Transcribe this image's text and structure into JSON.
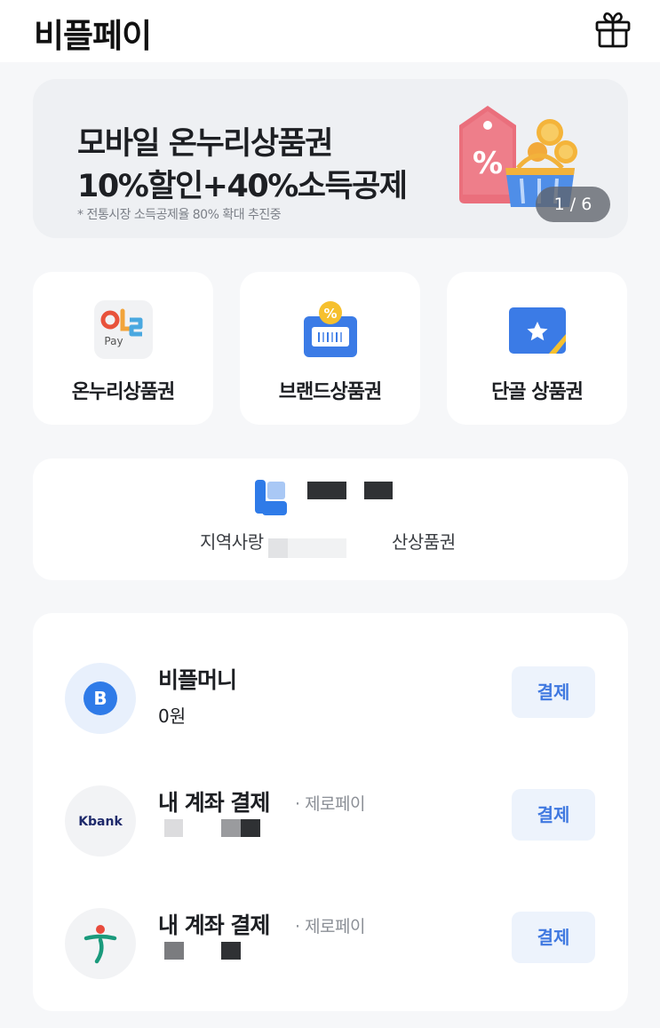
{
  "header": {
    "title": "비플페이",
    "gift_icon": "gift-icon"
  },
  "banner": {
    "line1": "모바일 온누리상품권",
    "line2": "10%할인+40%소득공제",
    "note": "* 전통시장 소득공제율 80% 확대 추진중",
    "page_indicator": "1 / 6",
    "art_icon": "sale-tag-basket-icon"
  },
  "vouchers": [
    {
      "label": "온누리상품권",
      "icon": "onnuri-pay-icon",
      "icon_text": "Pay"
    },
    {
      "label": "브랜드상품권",
      "icon": "brand-voucher-icon",
      "icon_text": "%"
    },
    {
      "label": "단골 상품권",
      "icon": "star-card-icon"
    }
  ],
  "region": {
    "label_left": "지역사랑",
    "label_right": "산상품권",
    "icon": "region-voucher-icon"
  },
  "payments": [
    {
      "name": "비플머니",
      "sub": "",
      "value": "0원",
      "button": "결제",
      "icon": "b-logo-icon",
      "logo_text": "B"
    },
    {
      "name": "내 계좌 결제",
      "sub": "· 제로페이",
      "value": "",
      "button": "결제",
      "icon": "kbank-logo-icon",
      "logo_text": "Kbank"
    },
    {
      "name": "내 계좌 결제",
      "sub": "· 제로페이",
      "value": "",
      "button": "결제",
      "icon": "hana-logo-icon",
      "logo_text": ""
    }
  ],
  "colors": {
    "accent": "#3f78e0",
    "button_bg": "#edf3fc",
    "page_bg": "#f6f7f9",
    "banner_bg": "#eef0f3"
  }
}
